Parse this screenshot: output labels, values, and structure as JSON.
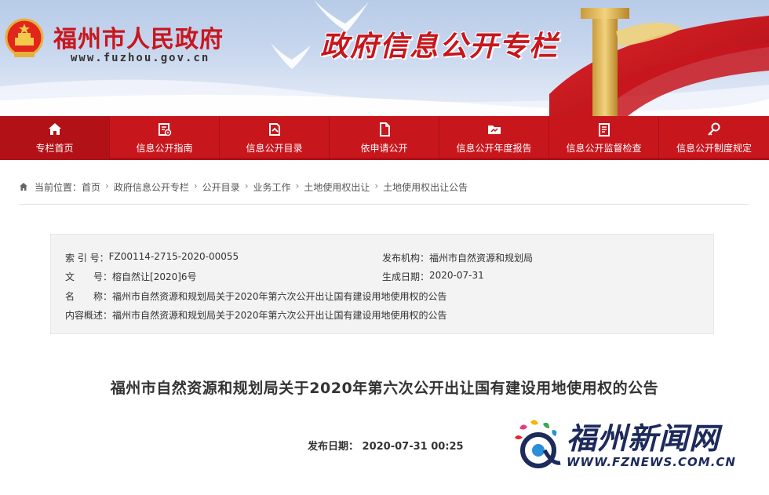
{
  "banner": {
    "site_name": "福州市人民政府",
    "site_url": "www.fuzhou.gov.cn",
    "column_title": "政府信息公开专栏"
  },
  "nav": {
    "items": [
      {
        "label": "专栏首页",
        "icon": "home-icon"
      },
      {
        "label": "信息公开指南",
        "icon": "guide-icon"
      },
      {
        "label": "信息公开目录",
        "icon": "catalog-icon"
      },
      {
        "label": "依申请公开",
        "icon": "document-icon"
      },
      {
        "label": "信息公开年度报告",
        "icon": "report-icon"
      },
      {
        "label": "信息公开监督检查",
        "icon": "inspection-icon"
      },
      {
        "label": "信息公开制度规定",
        "icon": "rules-icon"
      }
    ]
  },
  "breadcrumb": {
    "prefix": "当前位置：",
    "items": [
      "首页",
      "政府信息公开专栏",
      "公开目录",
      "业务工作",
      "土地使用权出让",
      "土地使用权出让公告"
    ],
    "separator": "›"
  },
  "meta": {
    "index_label": "索 引 号：",
    "index_value": "FZ00114-2715-2020-00055",
    "publisher_label": "发布机构：",
    "publisher_value": "福州市自然资源和规划局",
    "docno_label": "文　　号：",
    "docno_value": "榕自然让[2020]6号",
    "created_label": "生成日期：",
    "created_value": "2020-07-31",
    "name_label": "名　　称：",
    "name_value": "福州市自然资源和规划局关于2020年第六次公开出让国有建设用地使用权的公告",
    "summary_label": "内容概述：",
    "summary_value": "福州市自然资源和规划局关于2020年第六次公开出让国有建设用地使用权的公告"
  },
  "article": {
    "title": "福州市自然资源和规划局关于2020年第六次公开出让国有建设用地使用权的公告",
    "date_label": "发布日期：",
    "date_value": "2020-07-31 00:25"
  },
  "watermark": {
    "name": "福州新闻网",
    "url": "WWW.FZNEWS.COM.CN"
  },
  "colors": {
    "brand_red": "#c8161d",
    "watermark_blue": "#1c2a5c"
  }
}
